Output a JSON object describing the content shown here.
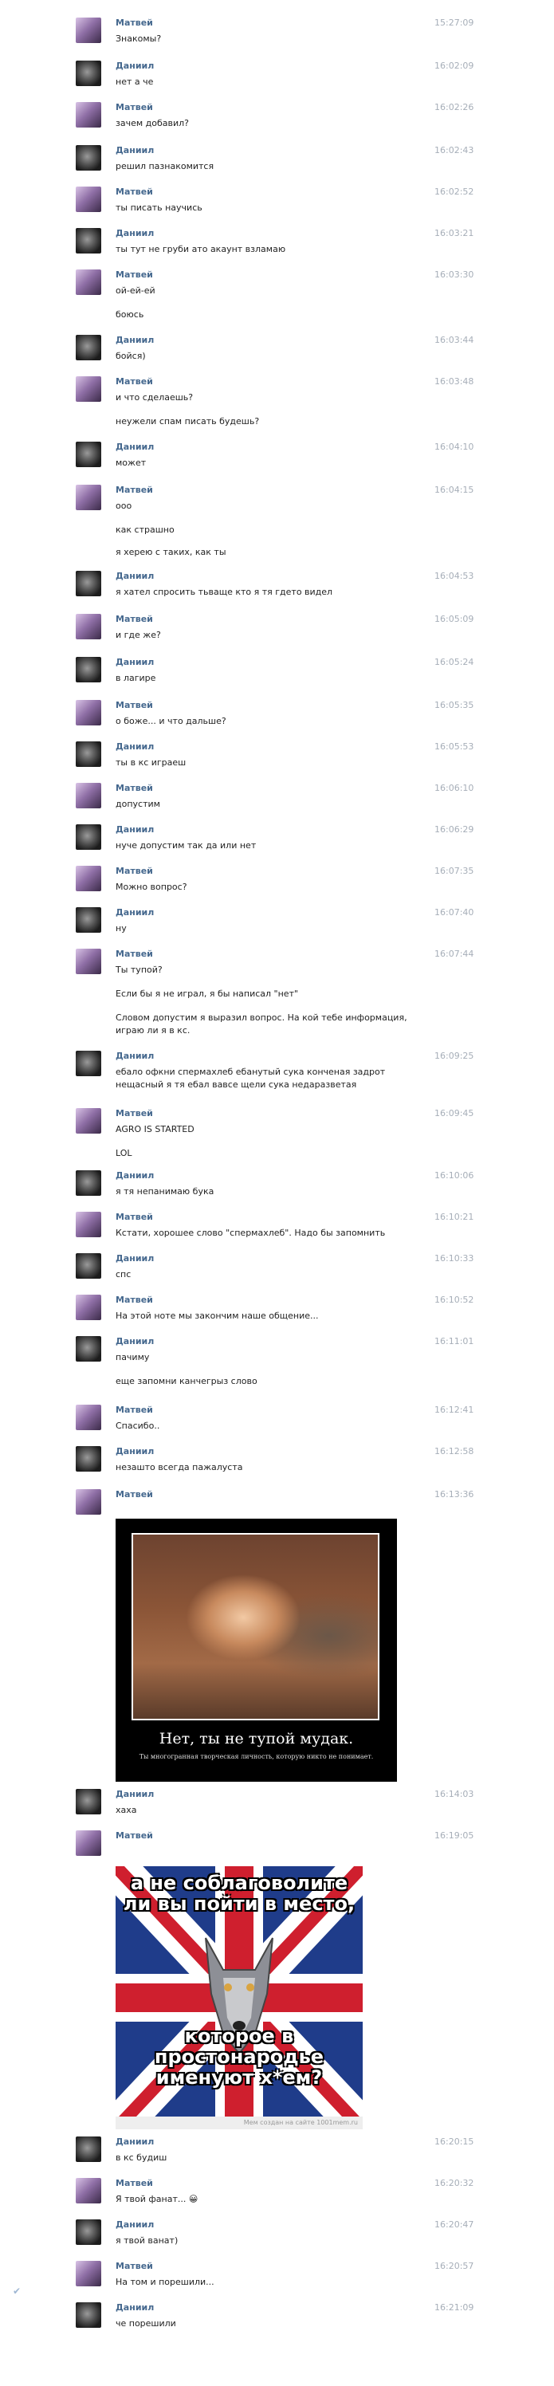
{
  "users": {
    "matvey": "Матвей",
    "daniil": "Даниил"
  },
  "messages": [
    {
      "author": "Матвей",
      "time": "15:27:09",
      "lines": [
        "Знакомы?"
      ]
    },
    {
      "author": "Даниил",
      "time": "16:02:09",
      "lines": [
        "нет а че"
      ]
    },
    {
      "author": "Матвей",
      "time": "16:02:26",
      "lines": [
        "зачем добавил?"
      ]
    },
    {
      "author": "Даниил",
      "time": "16:02:43",
      "lines": [
        "решил пазнакомится"
      ]
    },
    {
      "author": "Матвей",
      "time": "16:02:52",
      "lines": [
        "ты писать научись"
      ]
    },
    {
      "author": "Даниил",
      "time": "16:03:21",
      "lines": [
        "ты тут не груби ато акаунт взламаю"
      ]
    },
    {
      "author": "Матвей",
      "time": "16:03:30",
      "lines": [
        "ой-ей-ей",
        "боюсь"
      ]
    },
    {
      "author": "Даниил",
      "time": "16:03:44",
      "lines": [
        "бойся)"
      ]
    },
    {
      "author": "Матвей",
      "time": "16:03:48",
      "lines": [
        "и что сделаешь?",
        "неужели спам писать будешь?"
      ]
    },
    {
      "author": "Даниил",
      "time": "16:04:10",
      "lines": [
        "может"
      ]
    },
    {
      "author": "Матвей",
      "time": "16:04:15",
      "lines": [
        "ооо",
        "как страшно",
        "я херею с таких, как ты"
      ]
    },
    {
      "author": "Даниил",
      "time": "16:04:53",
      "lines": [
        "я хател спросить тьваще кто я тя гдето видел"
      ]
    },
    {
      "author": "Матвей",
      "time": "16:05:09",
      "lines": [
        "и где же?"
      ]
    },
    {
      "author": "Даниил",
      "time": "16:05:24",
      "lines": [
        "в лагире"
      ]
    },
    {
      "author": "Матвей",
      "time": "16:05:35",
      "lines": [
        "о боже... и что дальше?"
      ]
    },
    {
      "author": "Даниил",
      "time": "16:05:53",
      "lines": [
        "ты в кс играеш"
      ]
    },
    {
      "author": "Матвей",
      "time": "16:06:10",
      "lines": [
        "допустим"
      ]
    },
    {
      "author": "Даниил",
      "time": "16:06:29",
      "lines": [
        "нуче допустим так да или нет"
      ]
    },
    {
      "author": "Матвей",
      "time": "16:07:35",
      "lines": [
        "Можно вопрос?"
      ]
    },
    {
      "author": "Даниил",
      "time": "16:07:40",
      "lines": [
        "ну"
      ]
    },
    {
      "author": "Матвей",
      "time": "16:07:44",
      "lines": [
        "Ты тупой?",
        "Если бы я не играл, я бы написал \"нет\"",
        "Словом допустим я выразил вопрос. На кой тебе информация,",
        "играю ли я в кс."
      ]
    },
    {
      "author": "Даниил",
      "time": "16:09:25",
      "lines": [
        "ебало офкни спермахлеб ебанутый сука конченая задрот",
        "нещасный я тя ебал вавсе щели сука недаразветая"
      ]
    },
    {
      "author": "Матвей",
      "time": "16:09:45",
      "lines": [
        "AGRO IS STARTED",
        "LOL"
      ]
    },
    {
      "author": "Даниил",
      "time": "16:10:06",
      "lines": [
        "я тя непанимаю бука"
      ]
    },
    {
      "author": "Матвей",
      "time": "16:10:21",
      "lines": [
        "Кстати, хорошее слово \"спермахлеб\". Надо бы запомнить"
      ]
    },
    {
      "author": "Даниил",
      "time": "16:10:33",
      "lines": [
        "спс"
      ]
    },
    {
      "author": "Матвей",
      "time": "16:10:52",
      "lines": [
        "На этой ноте мы закончим наше общение..."
      ]
    },
    {
      "author": "Даниил",
      "time": "16:11:01",
      "lines": [
        "пачиму",
        "еще запомни канчегрыз слово"
      ]
    },
    {
      "author": "Матвей",
      "time": "16:12:41",
      "lines": [
        "Спасибо.."
      ]
    },
    {
      "author": "Даниил",
      "time": "16:12:58",
      "lines": [
        "незашто всегда пажалуста"
      ]
    },
    {
      "author": "Матвей",
      "time": "16:13:36",
      "lines": []
    },
    {
      "author": "Даниил",
      "time": "16:14:03",
      "lines": [
        "хаха"
      ]
    },
    {
      "author": "Матвей",
      "time": "16:19:05",
      "lines": []
    },
    {
      "author": "Даниил",
      "time": "16:20:15",
      "lines": [
        "в кс будиш"
      ]
    },
    {
      "author": "Матвей",
      "time": "16:20:32",
      "lines": [
        "Я твой фанат... 😀"
      ]
    },
    {
      "author": "Даниил",
      "time": "16:20:47",
      "lines": [
        "я твой ванат)"
      ]
    },
    {
      "author": "Матвей",
      "time": "16:20:57",
      "lines": [
        "На том и порешили..."
      ]
    },
    {
      "author": "Даниил",
      "time": "16:21:09",
      "lines": [
        "че порешили"
      ]
    }
  ],
  "demotivator": {
    "caption": "Нет, ты не тупой мудак.",
    "subcaption": "Ты многогранная творческая личность, которую никто не понимает."
  },
  "wolf_meme": {
    "top_text": "а не соблаговолите ли вы пойти в место,",
    "bottom_text": "которое в простонародье именуют х*ем?",
    "footer": "Мем создан на сайте 1001mem.ru"
  },
  "icons": {
    "check": "check-icon"
  }
}
